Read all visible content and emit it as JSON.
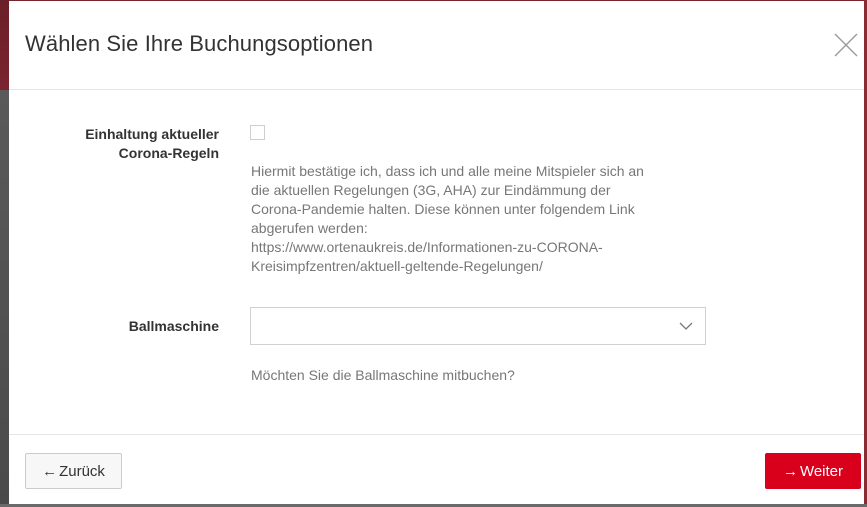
{
  "modal": {
    "title": "Wählen Sie Ihre Buchungsoptionen",
    "close_icon": "close-icon"
  },
  "corona": {
    "label_line1": "Einhaltung aktueller",
    "label_line2": "Corona-Regeln",
    "checked": false,
    "help_lines": [
      "Hiermit bestätige ich, dass ich und alle meine Mitspieler sich an",
      "die aktuellen Regelungen (3G, AHA) zur Eindämmung der",
      "Corona-Pandemie halten. Diese können unter folgendem Link",
      "abgerufen werden:",
      "https://www.ortenaukreis.de/Informationen-zu-CORONA-",
      "Kreisimpfzentren/aktuell-geltende-Regelungen/"
    ]
  },
  "ballmaschine": {
    "label": "Ballmaschine",
    "selected_value": "",
    "help": "Möchten Sie die Ballmaschine mitbuchen?"
  },
  "footer": {
    "back_label": "Zurück",
    "back_arrow": "←",
    "next_label": "Weiter",
    "next_arrow": "→"
  },
  "colors": {
    "primary": "#d9001b",
    "text": "#333333",
    "muted": "#777777",
    "border": "#e6e6e6"
  }
}
